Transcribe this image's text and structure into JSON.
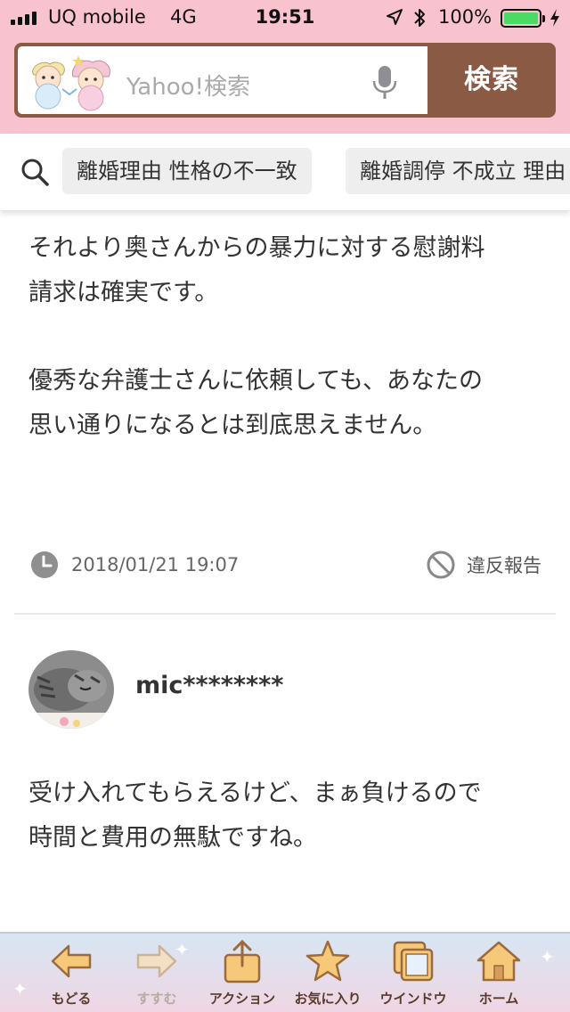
{
  "status_bar": {
    "carrier": "UQ mobile",
    "network": "4G",
    "time": "19:51",
    "battery_percent": "100%",
    "battery_level": 1.0,
    "battery_color": "#4cd964"
  },
  "search": {
    "placeholder": "Yahoo!検索",
    "button_label": "検索",
    "mic_icon": "microphone-icon",
    "accent_color": "#8a5a45",
    "header_color": "#f9c2cf"
  },
  "suggestions": {
    "icon": "search-icon",
    "chips": [
      "離婚理由 性格の不一致",
      "離婚調停 不成立 理由"
    ]
  },
  "answer": {
    "paragraph1_line1": "それより奥さんからの暴力に対する慰謝料",
    "paragraph1_line2": "請求は確実です。",
    "paragraph2_line1": "優秀な弁護士さんに依頼しても、あなたの",
    "paragraph2_line2": "思い通りになるとは到底思えません。",
    "timestamp": "2018/01/21 19:07",
    "report_label": "違反報告"
  },
  "next_answer": {
    "username": "mic********",
    "text_line1": "受け入れてもらえるけど、まぁ負けるので",
    "text_line2": "時間と費用の無駄ですね。"
  },
  "toolbar": {
    "back": "もどる",
    "forward": "すすむ",
    "action": "アクション",
    "favorites": "お気に入り",
    "window": "ウインドウ",
    "home": "ホーム"
  }
}
